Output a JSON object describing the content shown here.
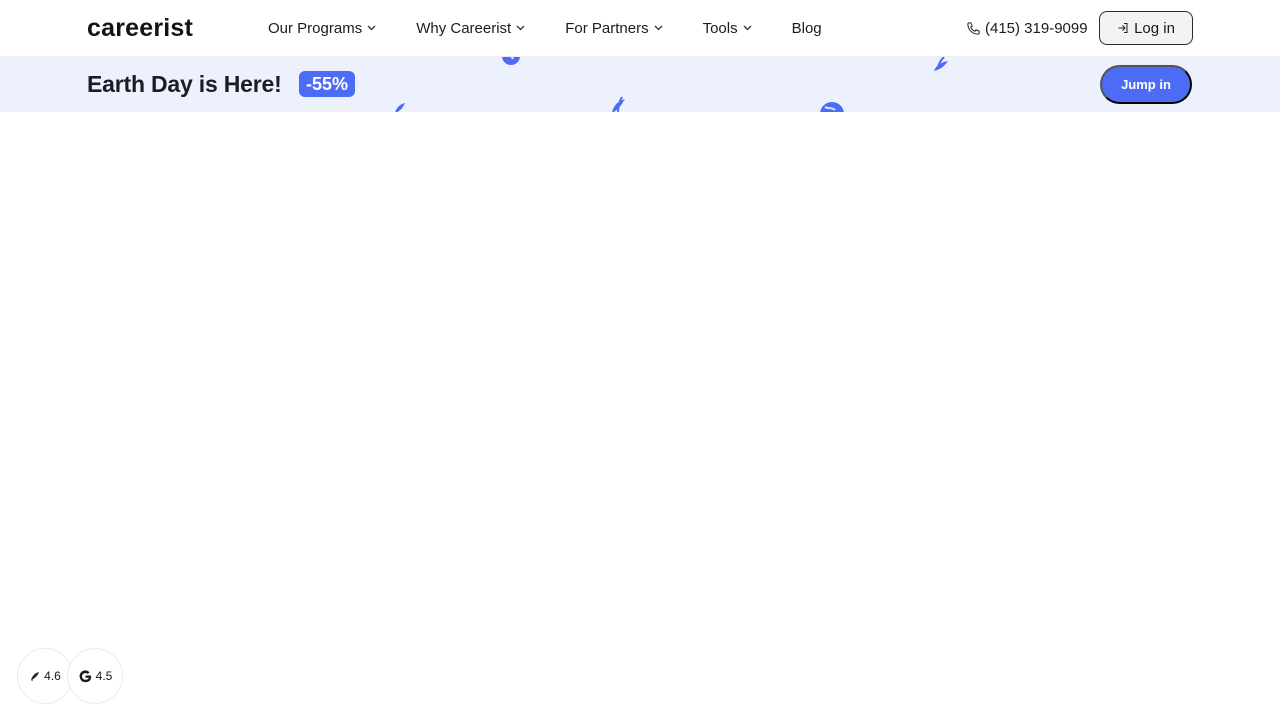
{
  "header": {
    "logo": "careerist",
    "nav": [
      {
        "label": "Our Programs",
        "dropdown": true
      },
      {
        "label": "Why Careerist",
        "dropdown": true
      },
      {
        "label": "For Partners",
        "dropdown": true
      },
      {
        "label": "Tools",
        "dropdown": true
      },
      {
        "label": "Blog",
        "dropdown": false
      }
    ],
    "phone": "(415) 319-9099",
    "phone_icon": "phone-icon",
    "login_label": "Log in",
    "login_icon": "login-icon"
  },
  "promo": {
    "title": "Earth Day is Here!",
    "badge": "-55%",
    "cta": "Jump in",
    "decorations": [
      "earth-icon",
      "leaf-icon"
    ]
  },
  "ratings": [
    {
      "icon": "trustpilot-icon",
      "score": "4.6"
    },
    {
      "icon": "google-icon",
      "score": "4.5"
    }
  ],
  "colors": {
    "accent": "#4d6cf5",
    "promo_bg": "#edf0fd",
    "text": "#1c1c1c"
  }
}
